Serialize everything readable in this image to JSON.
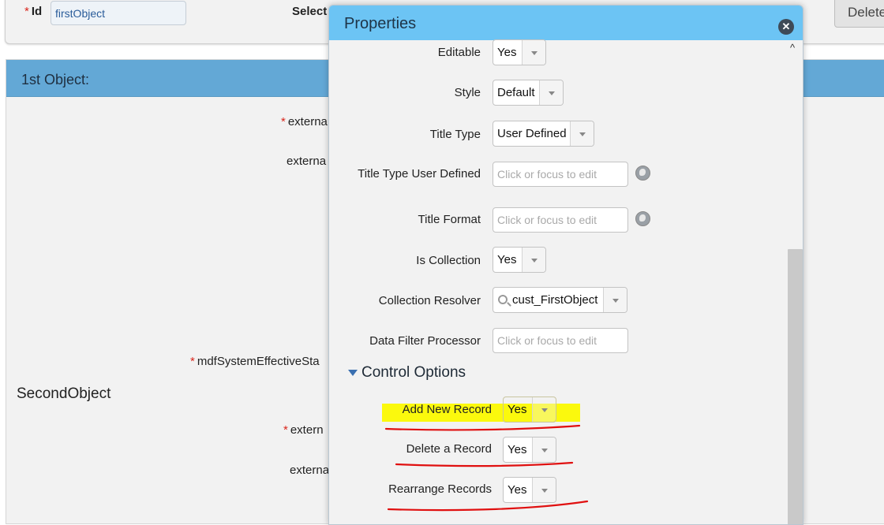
{
  "top": {
    "id_label": "Id",
    "id_value": "firstObject",
    "select_label": "Select",
    "delete_label": "Delete"
  },
  "section": {
    "title": "1st Object:",
    "fields": [
      "externa",
      "externa",
      "mdfSystemEffectiveSta",
      "extern",
      "externa"
    ],
    "second_object": "SecondObject"
  },
  "dialog": {
    "title": "Properties",
    "close_icon": "close-icon",
    "rows": [
      {
        "label": "Editable",
        "value": "Yes"
      },
      {
        "label": "Style",
        "value": "Default"
      },
      {
        "label": "Title Type",
        "value": "User Defined"
      },
      {
        "label": "Title Type User Defined",
        "placeholder": "Click or focus to edit"
      },
      {
        "label": "Title Format",
        "placeholder": "Click or focus to edit"
      },
      {
        "label": "Is Collection",
        "value": "Yes"
      },
      {
        "label": "Collection Resolver",
        "value": "cust_FirstObject"
      },
      {
        "label": "Data Filter Processor",
        "placeholder": "Click or focus to edit"
      }
    ],
    "control_options": {
      "title": "Control Options",
      "rows": [
        {
          "label": "Add New Record",
          "value": "Yes"
        },
        {
          "label": "Delete a Record",
          "value": "Yes"
        },
        {
          "label": "Rearrange Records",
          "value": "Yes"
        }
      ]
    }
  },
  "colors": {
    "dialog_header": "#6cc4f4",
    "section_header": "#63a8d6",
    "highlight": "#fbf900",
    "annotation_underline": "#e01010",
    "required_star": "#d9261c"
  }
}
